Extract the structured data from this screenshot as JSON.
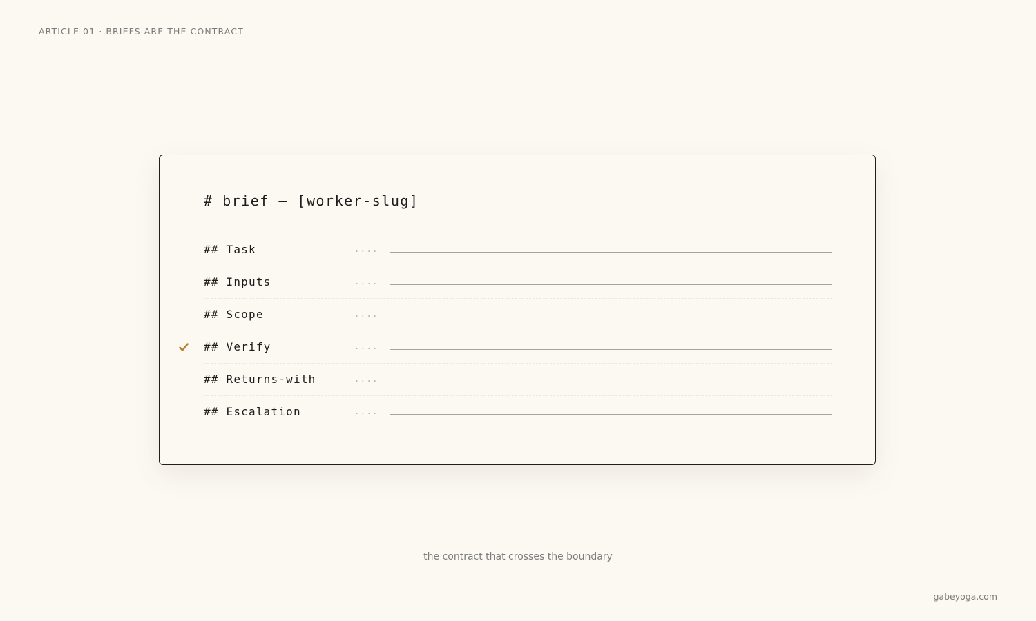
{
  "header": {
    "eyebrow": "ARTICLE 01 · BRIEFS ARE THE CONTRACT"
  },
  "card": {
    "title": "# brief — [worker-slug]",
    "rows": [
      {
        "label": "## Task",
        "dots": "....",
        "checked": false
      },
      {
        "label": "## Inputs",
        "dots": "....",
        "checked": false
      },
      {
        "label": "## Scope",
        "dots": "....",
        "checked": false
      },
      {
        "label": "## Verify",
        "dots": "....",
        "checked": true
      },
      {
        "label": "## Returns-with",
        "dots": "....",
        "checked": false
      },
      {
        "label": "## Escalation",
        "dots": "....",
        "checked": false
      }
    ]
  },
  "caption": "the contract that crosses the boundary",
  "footer": {
    "site": "gabeyoga.com"
  },
  "colors": {
    "background": "#fcf9f3",
    "check_accent": "#b97f32",
    "card_border": "#1f1f1f"
  },
  "icons": {
    "verify_marker": "checkmark-icon"
  }
}
